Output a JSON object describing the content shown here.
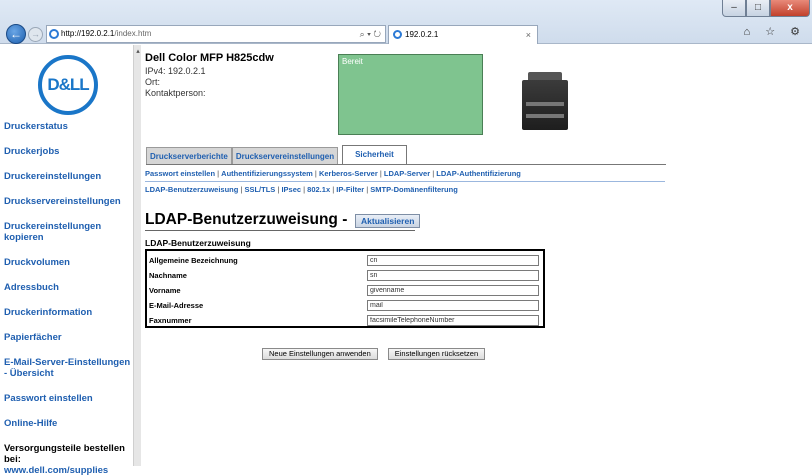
{
  "browser": {
    "url_host": "http://192.0.2.1",
    "url_path": "/index.htm",
    "address_tools": "⌕ ▾ ↻",
    "tab_title": "192.0.2.1",
    "tab_close": "×",
    "right_icons": "⌂ ☆ ⚙",
    "window_buttons": {
      "minimize": "–",
      "maximize": "□",
      "close": "x"
    }
  },
  "logo": {
    "text": "D&LL"
  },
  "sidebar": {
    "links": [
      "Druckerstatus",
      "Druckerjobs",
      "Druckereinstellungen",
      "Druckservereinstellungen",
      "Druckereinstellungen kopieren",
      "Druckvolumen",
      "Adressbuch",
      "Druckerinformation",
      "Papierfächer",
      "E-Mail-Server-Einstellungen - Übersicht",
      "Passwort einstellen",
      "Online-Hilfe"
    ],
    "supplies_label": "Versorgungsteile bestellen bei:",
    "supplies_link": "www.dell.com/supplies"
  },
  "device": {
    "name": "Dell Color MFP H825cdw",
    "ipv4": "IPv4: 192.0.2.1",
    "location": "Ort:",
    "contact": "Kontaktperson:",
    "status": "Bereit"
  },
  "tabs": [
    {
      "label": "Druckserverberichte",
      "active": false
    },
    {
      "label": "Druckservereinstellungen",
      "active": false
    },
    {
      "label": "Sicherheit",
      "active": true
    }
  ],
  "subnav1": [
    "Passwort einstellen",
    "Authentifizierungssystem",
    "Kerberos-Server",
    "LDAP-Server",
    "LDAP-Authentifizierung"
  ],
  "subnav2": [
    "LDAP-Benutzerzuweisung",
    "SSL/TLS",
    "IPsec",
    "802.1x",
    "IP-Filter",
    "SMTP-Domänenfilterung"
  ],
  "page_title": "LDAP-Benutzerzuweisung -",
  "refresh_label": "Aktualisieren",
  "section_title": "LDAP-Benutzerzuweisung",
  "fields": [
    {
      "label": "Allgemeine Bezeichnung",
      "value": "cn"
    },
    {
      "label": "Nachname",
      "value": "sn"
    },
    {
      "label": "Vorname",
      "value": "givenname"
    },
    {
      "label": "E-Mail-Adresse",
      "value": "mail"
    },
    {
      "label": "Faxnummer",
      "value": "facsimileTelephoneNumber"
    }
  ],
  "actions": {
    "apply": "Neue Einstellungen anwenden",
    "reset": "Einstellungen rücksetzen"
  },
  "colors": {
    "link": "#1f5fb0",
    "status_bg": "#7fc48f",
    "logo": "#1a76c8"
  }
}
